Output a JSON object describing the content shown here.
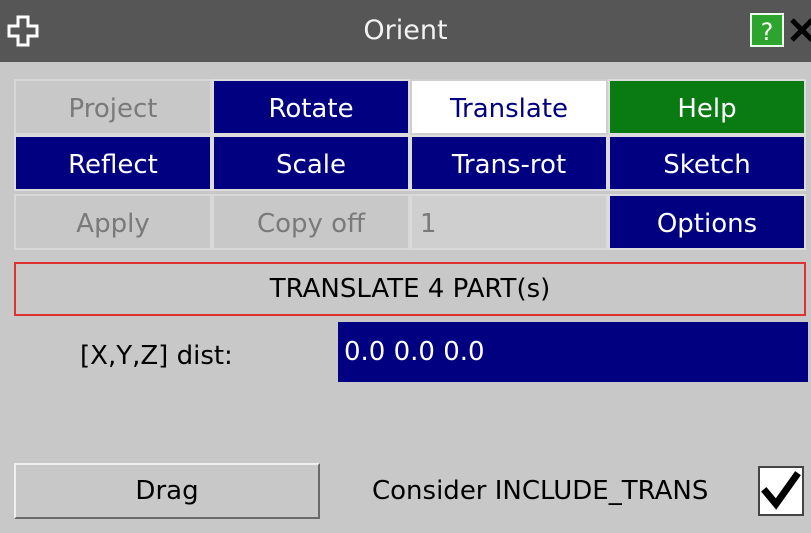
{
  "window": {
    "title": "Orient",
    "help_label": "?",
    "close_label": "✕"
  },
  "tabs": [
    {
      "label": "Project"
    },
    {
      "label": "Rotate"
    },
    {
      "label": "Translate"
    },
    {
      "label": "Help"
    },
    {
      "label": "Reflect"
    },
    {
      "label": "Scale"
    },
    {
      "label": "Trans-rot"
    },
    {
      "label": "Sketch"
    }
  ],
  "actions": {
    "apply_label": "Apply",
    "copy_label": "Copy off",
    "copy_count": "1",
    "options_label": "Options"
  },
  "status": {
    "text": "TRANSLATE 4 PART(s)"
  },
  "distance": {
    "label": "[X,Y,Z] dist:",
    "value": "0.0  0.0  0.0"
  },
  "bottom": {
    "drag_label": "Drag",
    "consider_label": "Consider INCLUDE_TRANS",
    "consider_checked": true
  },
  "colors": {
    "navy": "#000080",
    "green": "#0a7a12",
    "grey": "#c8c8c8",
    "titlebar": "#565656"
  }
}
